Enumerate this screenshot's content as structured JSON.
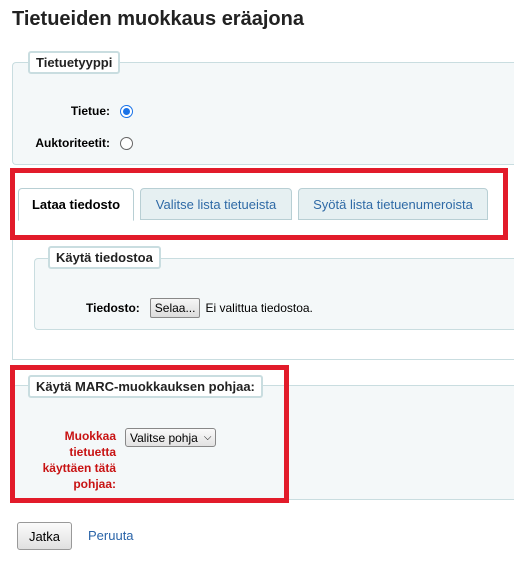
{
  "page": {
    "title": "Tietueiden muokkaus eräajona"
  },
  "record_type": {
    "legend": "Tietuetyyppi",
    "options": [
      {
        "label": "Tietue:",
        "checked": true
      },
      {
        "label": "Auktoriteetit:",
        "checked": false
      }
    ]
  },
  "tabs": [
    {
      "label": "Lataa tiedosto",
      "active": true
    },
    {
      "label": "Valitse lista tietueista",
      "active": false
    },
    {
      "label": "Syötä lista tietuenumeroista",
      "active": false
    }
  ],
  "file_upload": {
    "legend": "Käytä tiedostoa",
    "label": "Tiedosto:",
    "button": "Selaa...",
    "status": "Ei valittua tiedostoa."
  },
  "marc_template": {
    "legend": "Käytä MARC-muokkauksen pohjaa:",
    "label": "Muokkaa tietuetta käyttäen tätä pohjaa:",
    "select_value": "Valitse pohja"
  },
  "actions": {
    "submit": "Jatka",
    "cancel": "Peruuta"
  },
  "colors": {
    "highlight": "#e21b2a",
    "required_label": "#c81313",
    "link": "#2a64a8"
  }
}
